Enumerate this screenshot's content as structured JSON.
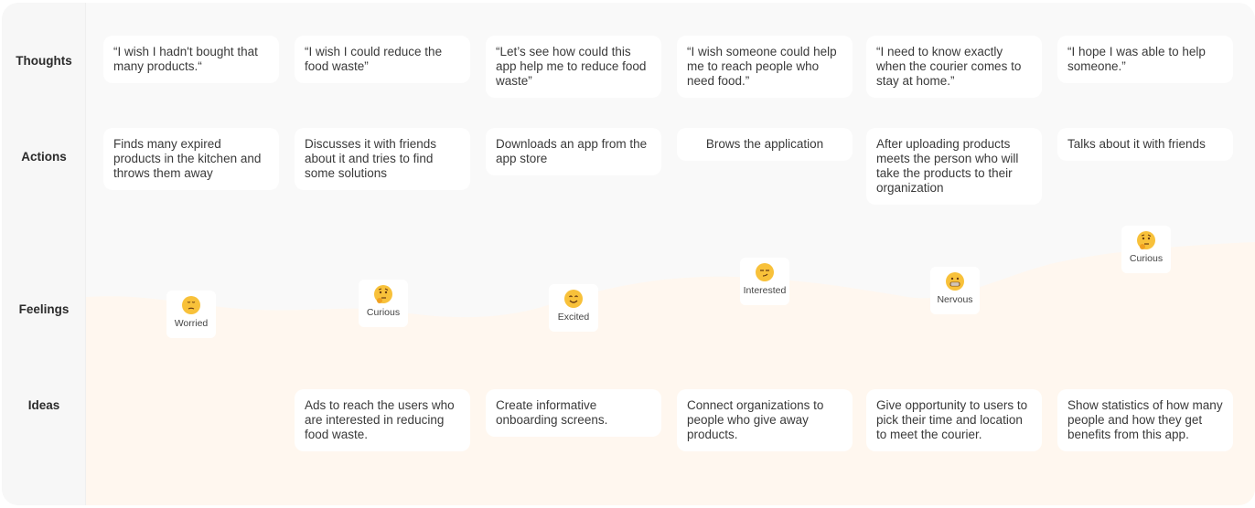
{
  "rows": {
    "thoughts": "Thoughts",
    "actions": "Actions",
    "feelings": "Feelings",
    "ideas": "Ideas"
  },
  "thoughts": [
    "“I wish I hadn't bought that many products.“",
    "“I wish I could reduce the food waste”",
    "“Let’s see how could this app help me to reduce food waste”",
    "“I wish someone could help me to reach people who need food.”",
    "“I need to know exactly when the courier comes to stay at home.”",
    "“I hope I was able to help someone.”"
  ],
  "actions": [
    "Finds many expired products in the kitchen and throws them away",
    "Discusses it with friends about it and tries to find some solutions",
    "Downloads an app from the app store",
    "Brows the application",
    "After uploading products meets the person who will take the products to their organization",
    "Talks about it with friends"
  ],
  "feelings": [
    {
      "label": "Worried",
      "icon": "pensive-face-icon"
    },
    {
      "label": "Curious",
      "icon": "thinking-face-icon"
    },
    {
      "label": "Excited",
      "icon": "smiling-face-icon"
    },
    {
      "label": "Interested",
      "icon": "smirking-face-icon"
    },
    {
      "label": "Nervous",
      "icon": "grimacing-face-icon"
    },
    {
      "label": "Curious",
      "icon": "thinking-face-icon"
    }
  ],
  "ideas": [
    "",
    "Ads to reach the users who are interested in reducing food waste.",
    "Create informative onboarding screens.",
    "Connect organizations to people who give away products.",
    "Give opportunity to users to pick their time and location to meet the courier.",
    "Show statistics of how many people and how they get benefits from this app."
  ],
  "colors": {
    "wave": "#fff7ef",
    "emoji": "#f8c13a"
  }
}
